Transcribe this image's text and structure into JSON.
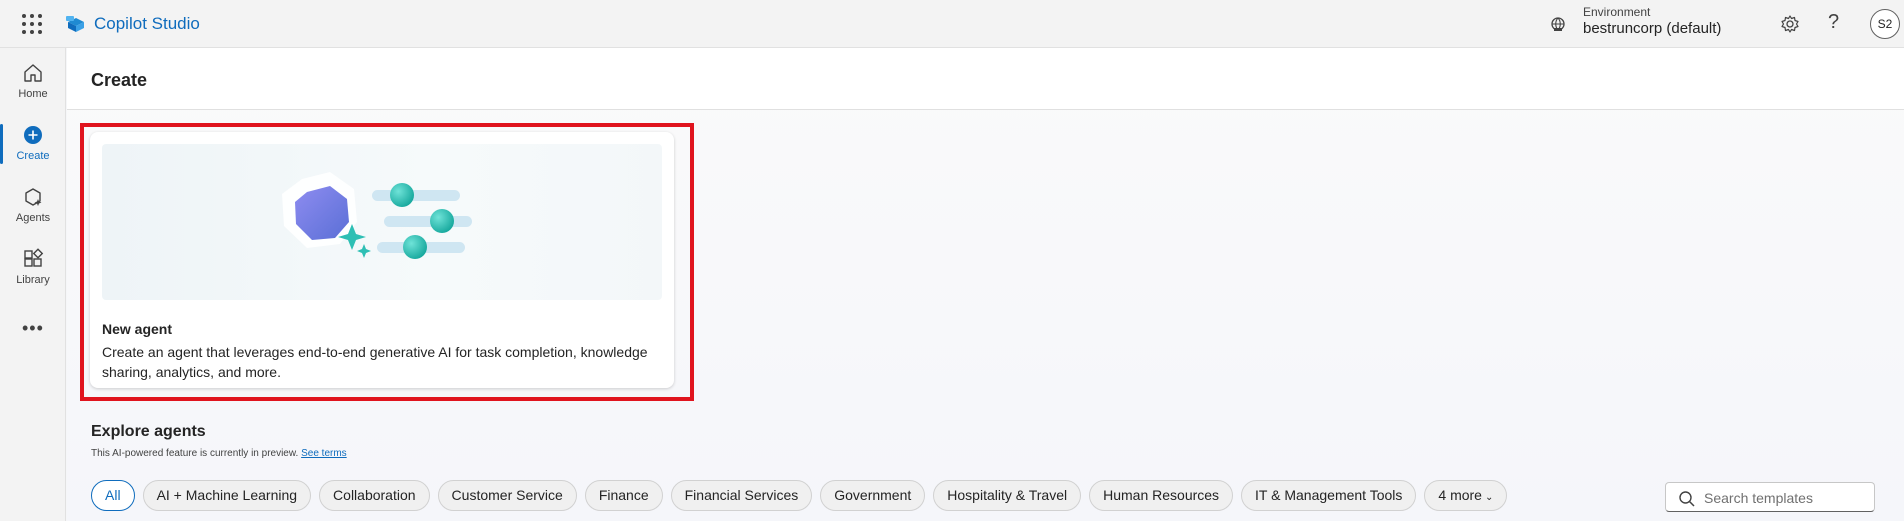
{
  "header": {
    "app_title": "Copilot Studio",
    "environment_label": "Environment",
    "environment_value": "bestruncorp (default)",
    "help_label": "?",
    "avatar_initials": "S2"
  },
  "rail": {
    "items": [
      {
        "label": "Home",
        "icon": "home-icon"
      },
      {
        "label": "Create",
        "icon": "plus-circle-icon",
        "active": true
      },
      {
        "label": "Agents",
        "icon": "agents-icon"
      },
      {
        "label": "Library",
        "icon": "library-icon"
      }
    ],
    "more_label": "•••"
  },
  "page": {
    "title": "Create",
    "new_agent": {
      "title": "New agent",
      "description": "Create an agent that leverages end-to-end generative AI for task completion, knowledge sharing, analytics, and more."
    },
    "explore": {
      "title": "Explore agents",
      "preview_note": "This AI-powered feature is currently in preview.",
      "see_terms": "See terms",
      "chips": [
        "All",
        "AI + Machine Learning",
        "Collaboration",
        "Customer Service",
        "Finance",
        "Financial Services",
        "Government",
        "Hospitality & Travel",
        "Human Resources",
        "IT & Management Tools",
        "4 more"
      ],
      "selected_chip": "All",
      "search_placeholder": "Search templates"
    }
  },
  "colors": {
    "accent": "#0f6cbd",
    "highlight_border": "#e0141e",
    "teal": "#2ebfb4"
  }
}
